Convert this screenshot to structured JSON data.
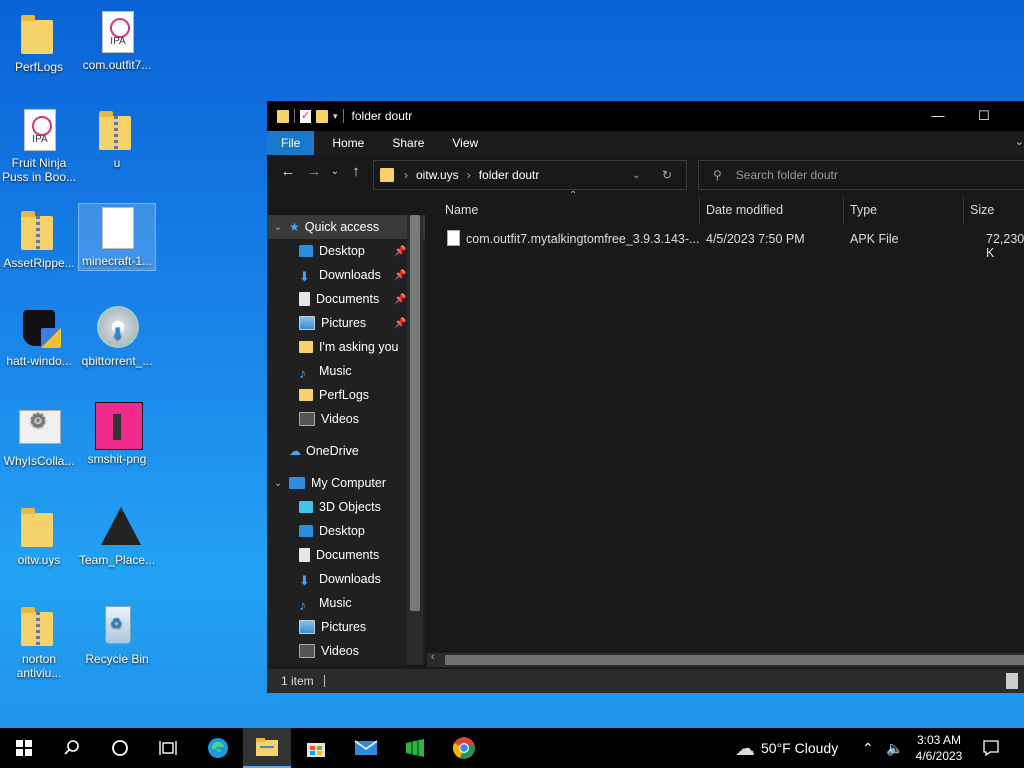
{
  "desktop": {
    "icons": [
      {
        "label": "PerfLogs",
        "kind": "folder"
      },
      {
        "label": "com.outfit7...",
        "kind": "ipa"
      },
      {
        "label": "Fruit Ninja Puss in Boo...",
        "kind": "ipa"
      },
      {
        "label": "u",
        "kind": "zip"
      },
      {
        "label": "AssetRippe...",
        "kind": "zip"
      },
      {
        "label": "minecraft-1...",
        "kind": "file"
      },
      {
        "label": "hatt-windo...",
        "kind": "app"
      },
      {
        "label": "qbittorrent_...",
        "kind": "app"
      },
      {
        "label": "WhyIsColla...",
        "kind": "app"
      },
      {
        "label": "smshit-png",
        "kind": "image"
      },
      {
        "label": "oitw.uys",
        "kind": "folder"
      },
      {
        "label": "Team_Place...",
        "kind": "app"
      },
      {
        "label": "norton antiviu...",
        "kind": "zip"
      },
      {
        "label": "Recycle Bin",
        "kind": "recycle"
      }
    ],
    "ipa_text": "IPA"
  },
  "explorer": {
    "title": "folder doutr",
    "window_controls": {
      "minimize": "—",
      "maximize": "☐",
      "close": "✕"
    },
    "ribbon_tabs": [
      "File",
      "Home",
      "Share",
      "View"
    ],
    "breadcrumb": [
      "oitw.uys",
      "folder doutr"
    ],
    "search_placeholder": "Search folder doutr",
    "nav": {
      "quick_access": "Quick access",
      "quick_items": [
        "Desktop",
        "Downloads",
        "Documents",
        "Pictures",
        "I'm  asking you",
        "Music",
        "PerfLogs",
        "Videos"
      ],
      "onedrive": "OneDrive",
      "computer": "My Computer",
      "computer_items": [
        "3D Objects",
        "Desktop",
        "Documents",
        "Downloads",
        "Music",
        "Pictures",
        "Videos"
      ]
    },
    "columns": [
      "Name",
      "Date modified",
      "Type",
      "Size"
    ],
    "files": [
      {
        "name": "com.outfit7.mytalkingtomfree_3.9.3.143-...",
        "date": "4/5/2023 7:50 PM",
        "type": "APK File",
        "size": "72,230 K"
      }
    ],
    "status": "1 item"
  },
  "taskbar": {
    "weather": "50°F  Cloudy",
    "time": "3:03 AM",
    "date": "4/6/2023"
  }
}
